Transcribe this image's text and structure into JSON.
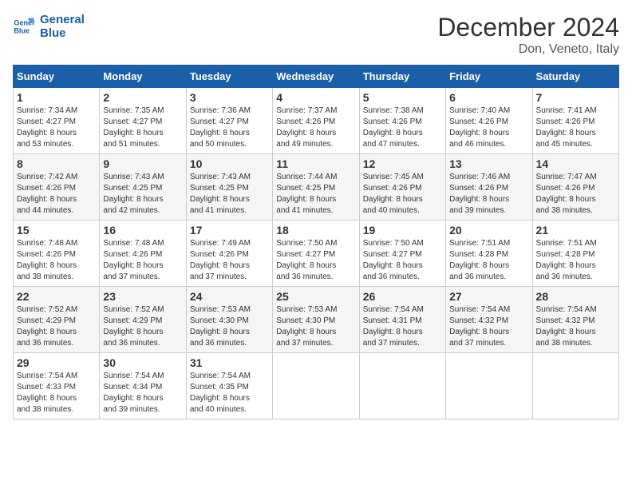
{
  "logo": {
    "line1": "General",
    "line2": "Blue"
  },
  "title": "December 2024",
  "subtitle": "Don, Veneto, Italy",
  "headers": [
    "Sunday",
    "Monday",
    "Tuesday",
    "Wednesday",
    "Thursday",
    "Friday",
    "Saturday"
  ],
  "weeks": [
    [
      {
        "day": "1",
        "sunrise": "7:34 AM",
        "sunset": "4:27 PM",
        "daylight": "8 hours and 53 minutes."
      },
      {
        "day": "2",
        "sunrise": "7:35 AM",
        "sunset": "4:27 PM",
        "daylight": "8 hours and 51 minutes."
      },
      {
        "day": "3",
        "sunrise": "7:36 AM",
        "sunset": "4:27 PM",
        "daylight": "8 hours and 50 minutes."
      },
      {
        "day": "4",
        "sunrise": "7:37 AM",
        "sunset": "4:26 PM",
        "daylight": "8 hours and 49 minutes."
      },
      {
        "day": "5",
        "sunrise": "7:38 AM",
        "sunset": "4:26 PM",
        "daylight": "8 hours and 47 minutes."
      },
      {
        "day": "6",
        "sunrise": "7:40 AM",
        "sunset": "4:26 PM",
        "daylight": "8 hours and 46 minutes."
      },
      {
        "day": "7",
        "sunrise": "7:41 AM",
        "sunset": "4:26 PM",
        "daylight": "8 hours and 45 minutes."
      }
    ],
    [
      {
        "day": "8",
        "sunrise": "7:42 AM",
        "sunset": "4:26 PM",
        "daylight": "8 hours and 44 minutes."
      },
      {
        "day": "9",
        "sunrise": "7:43 AM",
        "sunset": "4:25 PM",
        "daylight": "8 hours and 42 minutes."
      },
      {
        "day": "10",
        "sunrise": "7:43 AM",
        "sunset": "4:25 PM",
        "daylight": "8 hours and 41 minutes."
      },
      {
        "day": "11",
        "sunrise": "7:44 AM",
        "sunset": "4:25 PM",
        "daylight": "8 hours and 41 minutes."
      },
      {
        "day": "12",
        "sunrise": "7:45 AM",
        "sunset": "4:26 PM",
        "daylight": "8 hours and 40 minutes."
      },
      {
        "day": "13",
        "sunrise": "7:46 AM",
        "sunset": "4:26 PM",
        "daylight": "8 hours and 39 minutes."
      },
      {
        "day": "14",
        "sunrise": "7:47 AM",
        "sunset": "4:26 PM",
        "daylight": "8 hours and 38 minutes."
      }
    ],
    [
      {
        "day": "15",
        "sunrise": "7:48 AM",
        "sunset": "4:26 PM",
        "daylight": "8 hours and 38 minutes."
      },
      {
        "day": "16",
        "sunrise": "7:48 AM",
        "sunset": "4:26 PM",
        "daylight": "8 hours and 37 minutes."
      },
      {
        "day": "17",
        "sunrise": "7:49 AM",
        "sunset": "4:26 PM",
        "daylight": "8 hours and 37 minutes."
      },
      {
        "day": "18",
        "sunrise": "7:50 AM",
        "sunset": "4:27 PM",
        "daylight": "8 hours and 36 minutes."
      },
      {
        "day": "19",
        "sunrise": "7:50 AM",
        "sunset": "4:27 PM",
        "daylight": "8 hours and 36 minutes."
      },
      {
        "day": "20",
        "sunrise": "7:51 AM",
        "sunset": "4:28 PM",
        "daylight": "8 hours and 36 minutes."
      },
      {
        "day": "21",
        "sunrise": "7:51 AM",
        "sunset": "4:28 PM",
        "daylight": "8 hours and 36 minutes."
      }
    ],
    [
      {
        "day": "22",
        "sunrise": "7:52 AM",
        "sunset": "4:29 PM",
        "daylight": "8 hours and 36 minutes."
      },
      {
        "day": "23",
        "sunrise": "7:52 AM",
        "sunset": "4:29 PM",
        "daylight": "8 hours and 36 minutes."
      },
      {
        "day": "24",
        "sunrise": "7:53 AM",
        "sunset": "4:30 PM",
        "daylight": "8 hours and 36 minutes."
      },
      {
        "day": "25",
        "sunrise": "7:53 AM",
        "sunset": "4:30 PM",
        "daylight": "8 hours and 37 minutes."
      },
      {
        "day": "26",
        "sunrise": "7:54 AM",
        "sunset": "4:31 PM",
        "daylight": "8 hours and 37 minutes."
      },
      {
        "day": "27",
        "sunrise": "7:54 AM",
        "sunset": "4:32 PM",
        "daylight": "8 hours and 37 minutes."
      },
      {
        "day": "28",
        "sunrise": "7:54 AM",
        "sunset": "4:32 PM",
        "daylight": "8 hours and 38 minutes."
      }
    ],
    [
      {
        "day": "29",
        "sunrise": "7:54 AM",
        "sunset": "4:33 PM",
        "daylight": "8 hours and 38 minutes."
      },
      {
        "day": "30",
        "sunrise": "7:54 AM",
        "sunset": "4:34 PM",
        "daylight": "8 hours and 39 minutes."
      },
      {
        "day": "31",
        "sunrise": "7:54 AM",
        "sunset": "4:35 PM",
        "daylight": "8 hours and 40 minutes."
      },
      null,
      null,
      null,
      null
    ]
  ],
  "labels": {
    "sunrise": "Sunrise:",
    "sunset": "Sunset:",
    "daylight": "Daylight:"
  }
}
